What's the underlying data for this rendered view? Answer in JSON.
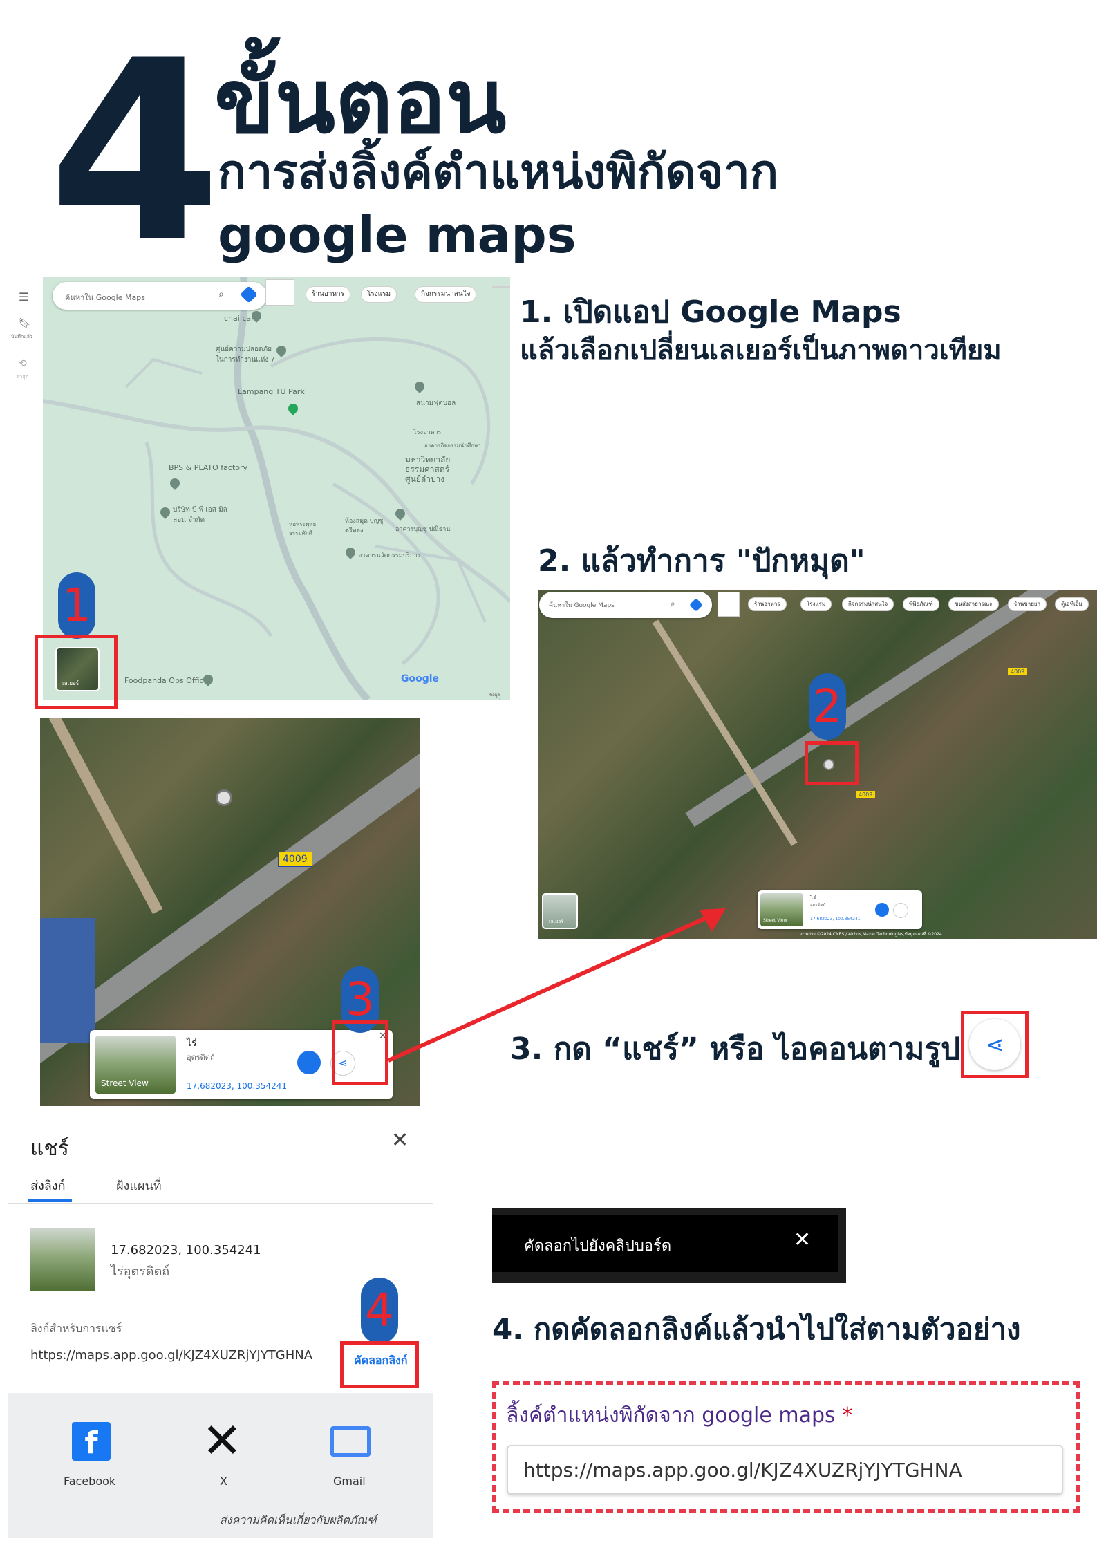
{
  "header": {
    "number": "4",
    "title": "ขั้นตอน",
    "subtitle_line1": "การส่งลิ้งค์ตำแหน่งพิกัดจาก",
    "subtitle_line2": "google maps"
  },
  "steps": {
    "step1": {
      "line1": "1. เปิดแอป Google Maps",
      "line2": "แล้วเลือกเปลี่ยนเลเยอร์เป็นภาพดาวเทียม",
      "badge": "1"
    },
    "step2": {
      "text": "2. แล้วทำการ \"ปักหมุด\"",
      "badge": "2"
    },
    "step3": {
      "text": "3. กด “แชร์” หรือ ไอคอนตามรูป",
      "badge": "3"
    },
    "step4": {
      "text": "4. กดคัดลอกลิงค์แล้วนำไปใส่ตามตัวอย่าง",
      "badge": "4"
    }
  },
  "map1": {
    "search_placeholder": "ค้นหาใน Google Maps",
    "sidebar_saved": "บันทึกแล้ว",
    "sidebar_recent": "ล่าสุด",
    "chips": [
      "ร้านอาหาร",
      "โรงแรม",
      "กิจกรรมน่าสนใจ"
    ],
    "labels": {
      "chai_car": "chai car",
      "center": "ศูนย์ความปลอดภัย ในการทำงานแห่ง 7",
      "tu_park": "Lampang TU Park",
      "football": "สนามฟุตบอล",
      "canteen": "โรงอาหาร",
      "activity": "อาคารกิจกรรมนักศึกษา",
      "university": "มหาวิทยาลัยธรรมศาสตร์ ศูนย์ลำปาง",
      "bps": "BPS & PLATO factory",
      "company": "บริษัท บี พี เอส มิลลอน จำกัด",
      "library": "ห้องสมุด บุญชูตรีทอง",
      "building1": "หอพระพุทธ ธรรมศักดิ์",
      "building2": "อาคารบุญชู ปณิธาน",
      "building3": "อาคารนวัตกรรมบริการ",
      "foodpanda": "Foodpanda Ops Office",
      "layer_btn": "เลเยอร์",
      "google": "Google",
      "copyright": "ข้อมูลแผนที่"
    }
  },
  "map2": {
    "search_placeholder": "ค้นหาใน Google Maps",
    "chips": [
      "ร้านอาหาร",
      "โรงแรม",
      "กิจกรรมน่าสนใจ",
      "พิพิธภัณฑ์",
      "ขนส่งสาธารณะ",
      "ร้านขายยา",
      "ตู้เอทีเอ็ม"
    ],
    "road_sign": "4009",
    "road_sign2": "4009",
    "layer_btn": "เลเยอร์",
    "card_title": "ไร่",
    "card_sub": "อุตรดิตถ์",
    "card_coords": "17.682023, 100.354241",
    "card_sv": "Street View",
    "footer": "ภาพถ่าย ©2024 CNES / Airbus,Maxar Technologies,ข้อมูลแผนที่ ©2024"
  },
  "map3": {
    "road_sign": "4009",
    "card_title": "ไร่",
    "card_sub": "อุตรดิตถ์",
    "card_coords": "17.682023, 100.354241",
    "card_sv": "Street View",
    "close": "×"
  },
  "share": {
    "title": "แชร์",
    "close": "✕",
    "tabs": [
      "ส่งลิงก์",
      "ฝังแผนที่"
    ],
    "coords": "17.682023, 100.354241",
    "place": "ไร่อุตรดิตถ์",
    "link_label": "ลิงก์สำหรับการแชร์",
    "link_value": "https://maps.app.goo.gl/KJZ4XUZRjYJYTGHNA",
    "copy_btn": "คัดลอกลิงก์",
    "apps": [
      "Facebook",
      "X",
      "Gmail"
    ],
    "feedback": "ส่งความคิดเห็นเกี่ยวกับผลิตภัณฑ์"
  },
  "toast": {
    "text": "คัดลอกไปยังคลิปบอร์ด",
    "close": "✕"
  },
  "form": {
    "label": "ลิ้งค์ตำแหน่งพิกัดจาก google maps",
    "required": "*",
    "value": "https://maps.app.goo.gl/KJZ4XUZRjYJYTGHNA"
  },
  "colors": {
    "navy": "#0f2236",
    "red": "#e8262b",
    "badge_blue": "#1f5fb4",
    "link_blue": "#1a73e8",
    "label_purple": "#4b2a8a"
  }
}
